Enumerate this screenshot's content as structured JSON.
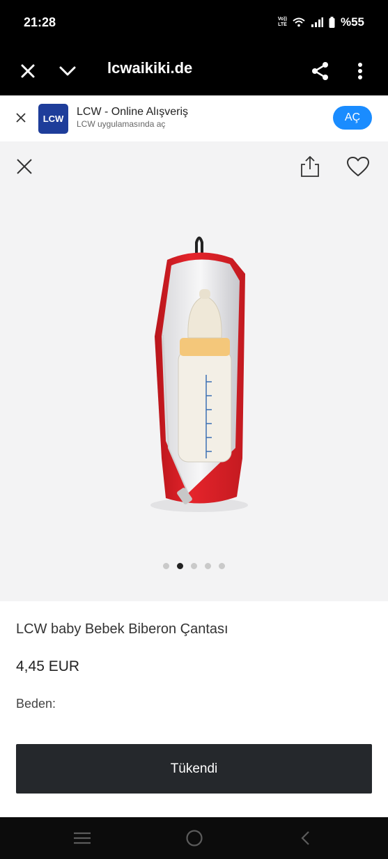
{
  "status_bar": {
    "time": "21:28",
    "volte_top": "Vo))",
    "volte_bottom": "LTE",
    "battery_text": "%55"
  },
  "browser": {
    "url": "lcwaikiki.de",
    "icons": [
      "close-icon",
      "chevron-down-icon",
      "share-icon",
      "more-vert-icon"
    ]
  },
  "app_banner": {
    "logo_text": "LCW",
    "title": "LCW - Online Alışveriş",
    "subtitle": "LCW uygulamasında aç",
    "open_label": "AÇ",
    "accent": "#1a8cff",
    "logo_color": "#1e3d9a"
  },
  "gallery": {
    "image_description_icon": "baby-bottle-bag",
    "total_images": 5,
    "active_index": 1,
    "bag_color": "#e5242b"
  },
  "product": {
    "name": "LCW baby Bebek Biberon Çantası",
    "price": "4,45 EUR",
    "size_label": "Beden:",
    "sold_out_label": "Tükendi"
  },
  "colors": {
    "button_bg": "#25282c",
    "gallery_bg": "#f3f3f4"
  }
}
